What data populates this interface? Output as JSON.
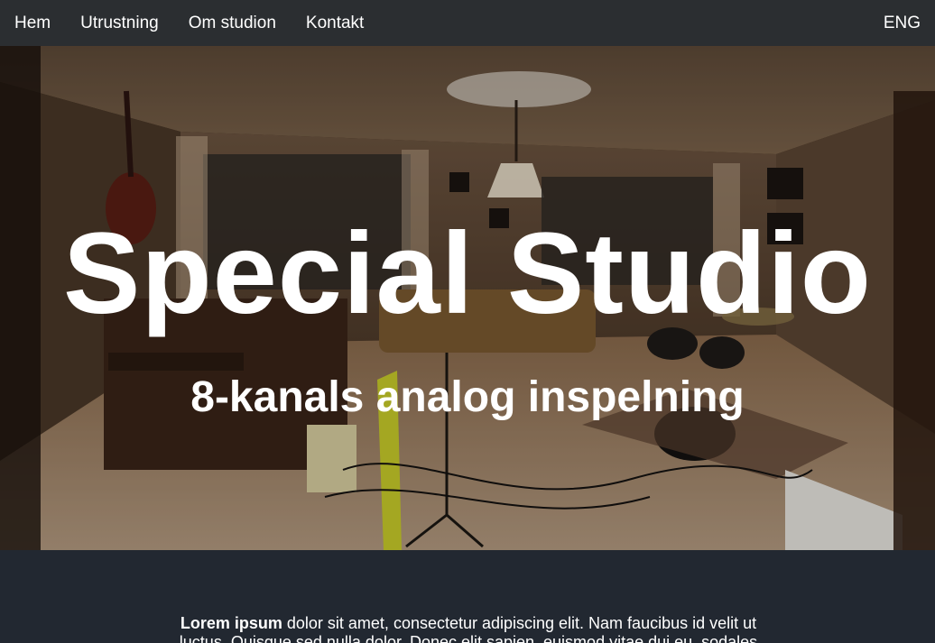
{
  "nav": {
    "items": [
      {
        "label": "Hem"
      },
      {
        "label": "Utrustning"
      },
      {
        "label": "Om studion"
      },
      {
        "label": "Kontakt"
      }
    ],
    "lang": "ENG"
  },
  "hero": {
    "title": "Special Studio",
    "subtitle": "8-kanals analog inspelning"
  },
  "intro": {
    "bold": "Lorem ipsum",
    "line1": " dolor sit amet, consectetur adipiscing elit. Nam faucibus id velit ut",
    "line2": "luctus. Quisque sed nulla dolor. Donec elit sapien, euismod vitae dui eu, sodales"
  },
  "colors": {
    "nav_bg": "#2b2e31",
    "page_bg": "#222831",
    "text": "#ffffff"
  }
}
